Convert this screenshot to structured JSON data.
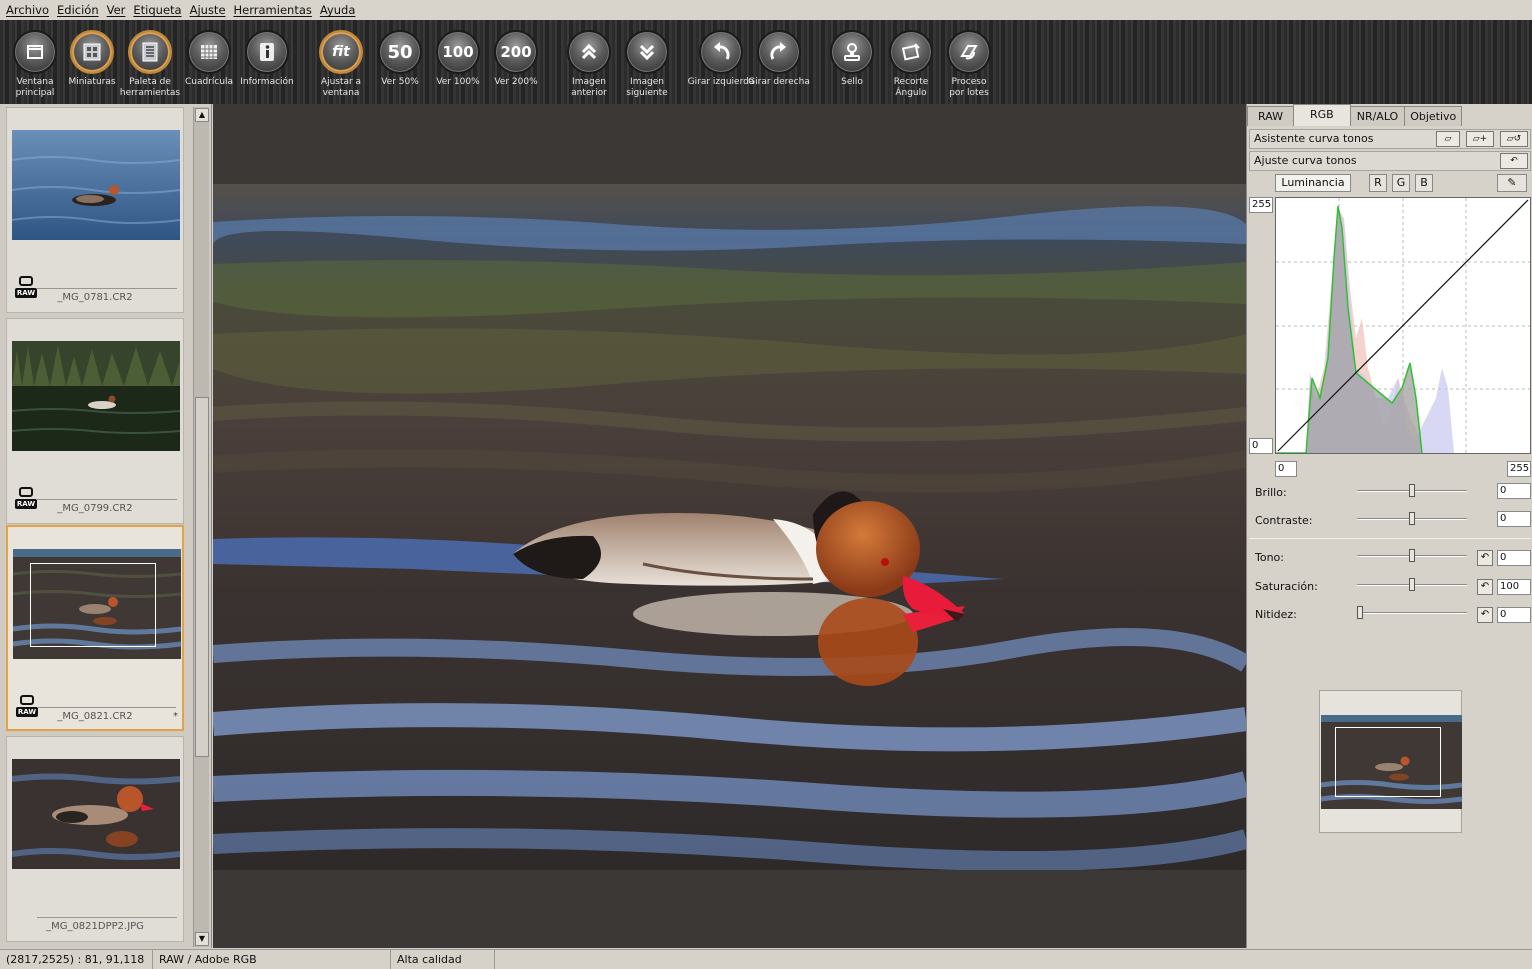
{
  "menu": [
    "Archivo",
    "Edición",
    "Ver",
    "Etiqueta",
    "Ajuste",
    "Herramientas",
    "Ayuda"
  ],
  "toolbar": [
    {
      "label": "Ventana\nprincipal",
      "icon": "main-window-icon"
    },
    {
      "label": "Miniaturas",
      "icon": "thumbnails-icon"
    },
    {
      "label": "Paleta de\nherramientas",
      "icon": "tool-palette-icon"
    },
    {
      "label": "Cuadrícula",
      "icon": "grid-icon"
    },
    {
      "label": "Información",
      "icon": "info-icon"
    },
    {
      "label": "Ajustar a\nventana",
      "icon": "fit-icon",
      "glyph": "fit"
    },
    {
      "label": "Ver 50%",
      "icon": "zoom-50-icon",
      "glyph": "50"
    },
    {
      "label": "Ver 100%",
      "icon": "zoom-100-icon",
      "glyph": "100"
    },
    {
      "label": "Ver 200%",
      "icon": "zoom-200-icon",
      "glyph": "200"
    },
    {
      "label": "Imagen\nanterior",
      "icon": "previous-image-icon"
    },
    {
      "label": "Imagen\nsiguiente",
      "icon": "next-image-icon"
    },
    {
      "label": "Girar izquierda",
      "icon": "rotate-left-icon"
    },
    {
      "label": "Girar derecha",
      "icon": "rotate-right-icon"
    },
    {
      "label": "Sello",
      "icon": "stamp-icon"
    },
    {
      "label": "Recorte\nÁngulo",
      "icon": "crop-icon"
    },
    {
      "label": "Proceso\npor lotes",
      "icon": "batch-process-icon"
    }
  ],
  "thumbnails": [
    {
      "filename": "_MG_0781.CR2",
      "badge": "RAW",
      "selected": false
    },
    {
      "filename": "_MG_0799.CR2",
      "badge": "RAW",
      "selected": false
    },
    {
      "filename": "_MG_0821.CR2",
      "badge": "RAW",
      "selected": true,
      "mark": "*"
    },
    {
      "filename": "_MG_0821DPP2.JPG",
      "badge": "",
      "selected": false
    }
  ],
  "right_panel": {
    "tabs": [
      "RAW",
      "RGB",
      "NR/ALO",
      "Objetivo"
    ],
    "active_tab": "RGB",
    "tone_curve_assist": "Asistente curva tonos",
    "tone_curve_adjust": "Ajuste curva tonos",
    "channels": [
      "Luminancia",
      "R",
      "G",
      "B"
    ],
    "active_channel": "Luminancia",
    "graph": {
      "y_max": "255",
      "y_min": "0",
      "x_min": "0",
      "x_max": "255"
    },
    "sliders": [
      {
        "label": "Brillo:",
        "value": "0",
        "level": 0.5,
        "reset": false
      },
      {
        "label": "Contraste:",
        "value": "0",
        "level": 0.5,
        "reset": false
      },
      {
        "label": "Tono:",
        "value": "0",
        "level": 0.5,
        "reset": true
      },
      {
        "label": "Saturación:",
        "value": "100",
        "level": 0.5,
        "reset": true
      },
      {
        "label": "Nitidez:",
        "value": "0",
        "level": 0.0,
        "reset": true
      }
    ]
  },
  "status": {
    "coords": "(2817,2525) :  81, 91,118",
    "mode": "RAW / Adobe RGB",
    "quality": "Alta calidad"
  },
  "colors": {
    "selection": "#e2a246",
    "toolbar_bg": "#2c2c2c",
    "panel_bg": "#d6d2ca"
  }
}
